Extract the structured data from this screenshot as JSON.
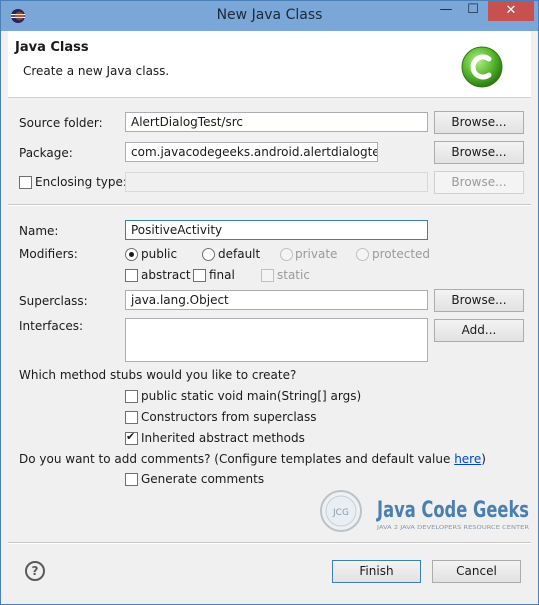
{
  "window": {
    "title": "New Java Class",
    "min_label": "—",
    "max_label": "☐",
    "close_label": "✕"
  },
  "header": {
    "title": "Java Class",
    "subtitle": "Create a new Java class."
  },
  "source_folder": {
    "label": "Source folder:",
    "value": "AlertDialogTest/src",
    "browse": "Browse..."
  },
  "package": {
    "label": "Package:",
    "value": "com.javacodegeeks.android.alertdialogtest",
    "browse": "Browse..."
  },
  "enclosing": {
    "label": "Enclosing type:",
    "value": "",
    "browse": "Browse...",
    "checked": false
  },
  "name": {
    "label": "Name:",
    "value": "PositiveActivity"
  },
  "modifiers": {
    "label": "Modifiers:",
    "options": [
      "public",
      "default",
      "private",
      "protected"
    ],
    "selected": "public",
    "abstract": "abstract",
    "final": "final",
    "static": "static"
  },
  "superclass": {
    "label": "Superclass:",
    "value": "java.lang.Object",
    "browse": "Browse..."
  },
  "interfaces": {
    "label": "Interfaces:",
    "add": "Add..."
  },
  "stubs": {
    "question": "Which method stubs would you like to create?",
    "main": "public static void main(String[] args)",
    "constructors": "Constructors from superclass",
    "inherited": "Inherited abstract methods"
  },
  "comments": {
    "question_prefix": "Do you want to add comments? (Configure templates and default value ",
    "link": "here",
    "question_suffix": ")",
    "generate": "Generate comments"
  },
  "watermark": {
    "logo_text": "Java Code Geeks",
    "tagline": "JAVA 2 JAVA DEVELOPERS RESOURCE CENTER",
    "badge": "JCG"
  },
  "footer": {
    "help": "?",
    "finish": "Finish",
    "cancel": "Cancel"
  },
  "colors": {
    "titlebar": "#7aa7d8",
    "close": "#c75050",
    "logo_green": "#55b82e",
    "link": "#0044cc"
  }
}
